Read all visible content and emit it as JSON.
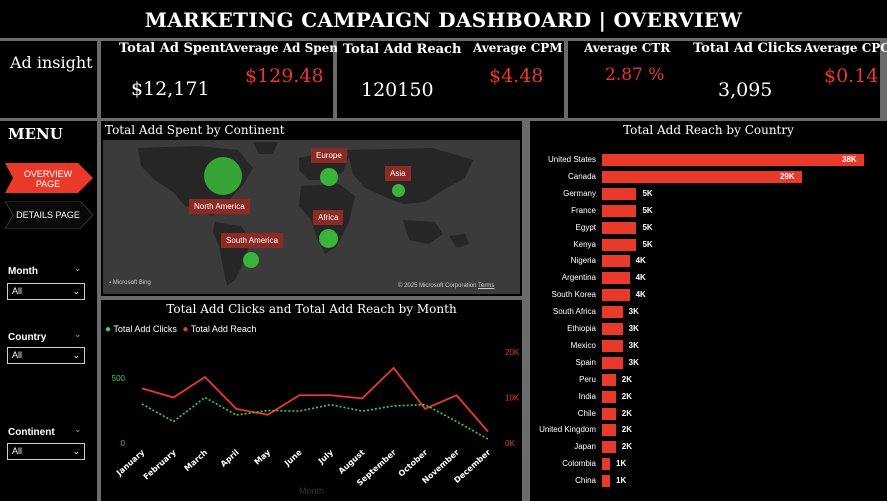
{
  "title": "MARKETING CAMPAIGN DASHBOARD | OVERVIEW",
  "ad_insight": "Ad insight",
  "kpis": {
    "total_ad_spent": {
      "label": "Total Ad Spent",
      "value": "$12,171"
    },
    "average_ad_spent": {
      "label": "Average Ad Spent",
      "value": "$129.48"
    },
    "total_add_reach": {
      "label": "Total Add Reach",
      "value": "120150"
    },
    "average_cpm": {
      "label": "Average CPM",
      "value": "$4.48"
    },
    "average_ctr": {
      "label": "Average CTR",
      "value": "2.87 %"
    },
    "total_ad_clicks": {
      "label": "Total Ad Clicks",
      "value": "3,095"
    },
    "average_cpc": {
      "label": "Average CPC",
      "value": "$0.14"
    }
  },
  "menu": {
    "title": "MENU",
    "overview": "OVERVIEW PAGE",
    "details": "DETAILS PAGE"
  },
  "slicers": {
    "month": {
      "label": "Month",
      "value": "All"
    },
    "country": {
      "label": "Country",
      "value": "All"
    },
    "continent": {
      "label": "Continent",
      "value": "All"
    }
  },
  "map": {
    "title": "Total Add Spent by Continent",
    "labels": {
      "north_america": "North America",
      "europe": "Europe",
      "asia": "Asia",
      "africa": "Africa",
      "south_america": "South America"
    },
    "bing": "Microsoft Bing",
    "copyright": "© 2025 Microsoft Corporation",
    "terms": "Terms"
  },
  "colors": {
    "accent_red": "#e8392a",
    "green": "#3fd13f",
    "bubble_green": "#39b339"
  },
  "chart_data": [
    {
      "type": "line",
      "title": "Total Add Clicks and Total Add Reach by Month",
      "xlabel": "Month",
      "categories": [
        "January",
        "February",
        "March",
        "April",
        "May",
        "June",
        "July",
        "August",
        "September",
        "October",
        "November",
        "December"
      ],
      "series": [
        {
          "name": "Total Add Clicks",
          "axis": "left",
          "values": [
            300,
            165,
            350,
            215,
            250,
            245,
            295,
            245,
            285,
            295,
            165,
            30
          ]
        },
        {
          "name": "Total Add Reach",
          "axis": "right",
          "values": [
            12000,
            10000,
            14500,
            7500,
            6200,
            10500,
            10500,
            9800,
            16500,
            7500,
            10500,
            2500
          ]
        }
      ],
      "left_ticks": [
        "0",
        "500"
      ],
      "right_ticks": [
        "0K",
        "10K",
        "20K"
      ],
      "ylim_left": [
        0,
        700
      ],
      "ylim_right": [
        0,
        20000
      ]
    },
    {
      "type": "bar",
      "orientation": "horizontal",
      "title": "Total Add Reach by Country",
      "categories": [
        "United States",
        "Canada",
        "Germany",
        "France",
        "Egypt",
        "Kenya",
        "Nigeria",
        "Argentina",
        "South Korea",
        "South Africa",
        "Ethiopia",
        "Mexico",
        "Spain",
        "Peru",
        "India",
        "Chile",
        "United Kingdom",
        "Japan",
        "Colombia",
        "China"
      ],
      "values": [
        38000,
        29000,
        5000,
        5000,
        5000,
        5000,
        4000,
        4000,
        4000,
        3000,
        3000,
        3000,
        3000,
        2000,
        2000,
        2000,
        2000,
        2000,
        1000,
        1000
      ],
      "labels": [
        "38K",
        "29K",
        "5K",
        "5K",
        "5K",
        "5K",
        "4K",
        "4K",
        "4K",
        "3K",
        "3K",
        "3K",
        "3K",
        "2K",
        "2K",
        "2K",
        "2K",
        "2K",
        "1K",
        "1K"
      ]
    }
  ]
}
